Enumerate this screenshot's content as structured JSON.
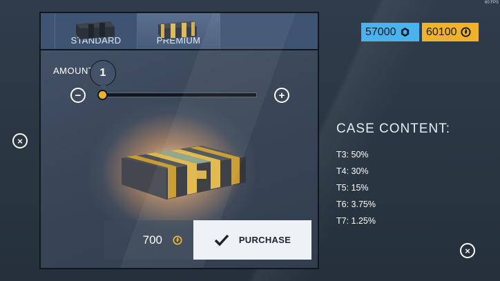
{
  "hud": {
    "fps": "60 FPS"
  },
  "currency": {
    "gems": {
      "value": "57000",
      "color": "#4ab2ef",
      "icon": "gem-icon"
    },
    "coins": {
      "value": "60100",
      "color": "#f0b22a",
      "icon": "coin-icon"
    }
  },
  "tabs": [
    {
      "label": "STANDARD",
      "icon": "standard-chest-icon"
    },
    {
      "label": "PREMIUM",
      "icon": "premium-chest-icon",
      "selected": true
    }
  ],
  "amount": {
    "label": "AMOUNT",
    "value": "1"
  },
  "purchase": {
    "price": "700",
    "price_icon": "coin-icon",
    "button_label": "PURCHASE"
  },
  "case_content": {
    "title": "CASE CONTENT:",
    "items": [
      "T3: 50%",
      "T4: 30%",
      "T5: 15%",
      "T6: 3.75%",
      "T7: 1.25%"
    ]
  }
}
